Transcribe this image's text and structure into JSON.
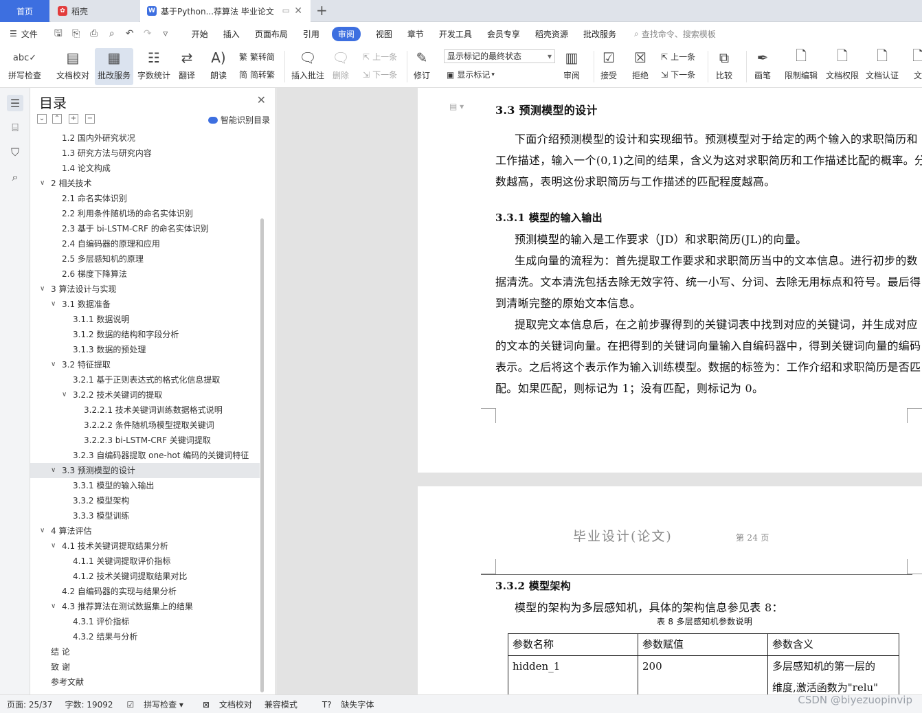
{
  "tabs": {
    "home": "首页",
    "daoke": "稻壳",
    "doc": "基于Python...荐算法 毕业论文"
  },
  "menu": {
    "file": "文件",
    "items": [
      "开始",
      "插入",
      "页面布局",
      "引用",
      "审阅",
      "视图",
      "章节",
      "开发工具",
      "会员专享",
      "稻壳资源",
      "批改服务"
    ],
    "active_index": 4,
    "search": "查找命令、搜索模板"
  },
  "ribbon": {
    "spell": "拼写检查",
    "proof": "文档校对",
    "review_service": "批改服务",
    "wordcount": "字数统计",
    "translate": "翻译",
    "read": "朗读",
    "trad2simp": "繁转简",
    "simp2trad": "简转繁",
    "insert_comment": "插入批注",
    "delete": "删除",
    "prev": "上一条",
    "next": "下一条",
    "revise": "修订",
    "markup_select": "显示标记的最终状态",
    "show_markup": "显示标记",
    "review_pane": "审阅",
    "accept": "接受",
    "reject": "拒绝",
    "prev2": "上一条",
    "next2": "下一条",
    "compare": "比较",
    "pen": "画笔",
    "restrict": "限制编辑",
    "doc_perm": "文档权限",
    "doc_cert": "文档认证",
    "doc_more": "文"
  },
  "toc": {
    "title": "目录",
    "smart": "智能识别目录",
    "items": [
      {
        "t": "1.2    国内外研究状况",
        "l": 1
      },
      {
        "t": "1.3    研究方法与研究内容",
        "l": 1
      },
      {
        "t": "1.4    论文构成",
        "l": 1
      },
      {
        "t": "2    相关技术",
        "l": 0,
        "c": 1
      },
      {
        "t": "2.1  命名实体识别",
        "l": 1
      },
      {
        "t": "2.2  利用条件随机场的命名实体识别",
        "l": 1
      },
      {
        "t": "2.3    基于 bi-LSTM-CRF 的命名实体识别",
        "l": 1
      },
      {
        "t": "2.4    自编码器的原理和应用",
        "l": 1
      },
      {
        "t": "2.5  多层感知机的原理",
        "l": 1
      },
      {
        "t": "2.6  梯度下降算法",
        "l": 1
      },
      {
        "t": "3  算法设计与实现",
        "l": 0,
        "c": 1
      },
      {
        "t": "3.1    数据准备",
        "l": 1,
        "c": 1
      },
      {
        "t": "3.1.1    数据说明",
        "l": 2
      },
      {
        "t": "3.1.2    数据的结构和字段分析",
        "l": 2
      },
      {
        "t": "3.1.3    数据的预处理",
        "l": 2
      },
      {
        "t": "3.2    特征提取",
        "l": 1,
        "c": 1
      },
      {
        "t": "3.2.1    基于正则表达式的格式化信息提取",
        "l": 2
      },
      {
        "t": "3.2.2    技术关键词的提取",
        "l": 2,
        "c": 1
      },
      {
        "t": "3.2.2.1    技术关键词训练数据格式说明",
        "l": 3
      },
      {
        "t": "3.2.2.2    条件随机场模型提取关键词",
        "l": 3
      },
      {
        "t": "3.2.2.3      bi-LSTM-CRF 关键词提取",
        "l": 3
      },
      {
        "t": "3.2.3    自编码器提取 one-hot 编码的关键词特征",
        "l": 2
      },
      {
        "t": "3.3    预测模型的设计",
        "l": 1,
        "c": 1,
        "sel": 1
      },
      {
        "t": "3.3.1    模型的输入输出",
        "l": 2
      },
      {
        "t": "3.3.2  模型架构",
        "l": 2
      },
      {
        "t": "3.3.3    模型训练",
        "l": 2
      },
      {
        "t": "4    算法评估",
        "l": 0,
        "c": 1
      },
      {
        "t": "4.1    技术关键词提取结果分析",
        "l": 1,
        "c": 1
      },
      {
        "t": "4.1.1    关键词提取评价指标",
        "l": 2
      },
      {
        "t": "4.1.2    技术关键词提取结果对比",
        "l": 2
      },
      {
        "t": "4.2    自编码器的实现与结果分析",
        "l": 1
      },
      {
        "t": "4.3    推荐算法在测试数据集上的结果",
        "l": 1,
        "c": 1
      },
      {
        "t": "4.3.1    评价指标",
        "l": 2
      },
      {
        "t": "4.3.2  结果与分析",
        "l": 2
      },
      {
        "t": "结    论",
        "l": 0
      },
      {
        "t": "致    谢",
        "l": 0
      },
      {
        "t": "参考文献",
        "l": 0
      }
    ]
  },
  "doc": {
    "h33": "3.3    预测模型的设计",
    "p1a": "下面介绍预测模型的设计和实现细节。预测模型对于给定的两个输入的求职简历和",
    "p1b": "工作描述，输入一个(0,1)之间的结果，含义为这对求职简历和工作描述比配的概率。分",
    "p1c": "数越高，表明这份求职简历与工作描述的匹配程度越高。",
    "h331": "3.3.1    模型的输入输出",
    "p2": "预测模型的输入是工作要求（JD）和求职简历(JL)的向量。",
    "p3a": "生成向量的流程为：首先提取工作要求和求职简历当中的文本信息。进行初步的数",
    "p3b": "据清洗。文本清洗包括去除无效字符、统一小写、分词、去除无用标点和符号。最后得",
    "p3c": "到清晰完整的原始文本信息。",
    "p4a": "提取完文本信息后，在之前步骤得到的关键词表中找到对应的关键词，并生成对应",
    "p4b": "的文本的关键词向量。在把得到的关键词向量输入自编码器中，得到关键词向量的编码",
    "p4c": "表示。之后将这个表示作为输入训练模型。数据的标签为：工作介绍和求职简历是否匹",
    "p4d": "配。如果匹配，则标记为 1；没有匹配，则标记为 0。",
    "header_title": "毕业设计(论文)",
    "header_page": "第    24    页",
    "h332": "3.3.2  模型架构",
    "p5": "模型的架构为多层感知机，具体的架构信息参见表 8：",
    "tbl_caption": "表 8  多层感知机参数说明",
    "tbl_head": [
      "参数名称",
      "参数赋值",
      "参数含义"
    ],
    "tbl_row": [
      "hidden_1",
      "200",
      "多层感知机的第一层的"
    ],
    "tbl_row2": "维度,激活函数为\"relu\""
  },
  "status": {
    "page": "页面: 25/37",
    "words": "字数: 19092",
    "spell": "拼写检查",
    "proof": "文档校对",
    "compat": "兼容模式",
    "font": "缺失字体"
  },
  "watermark": "CSDN @biyezuopinvip"
}
